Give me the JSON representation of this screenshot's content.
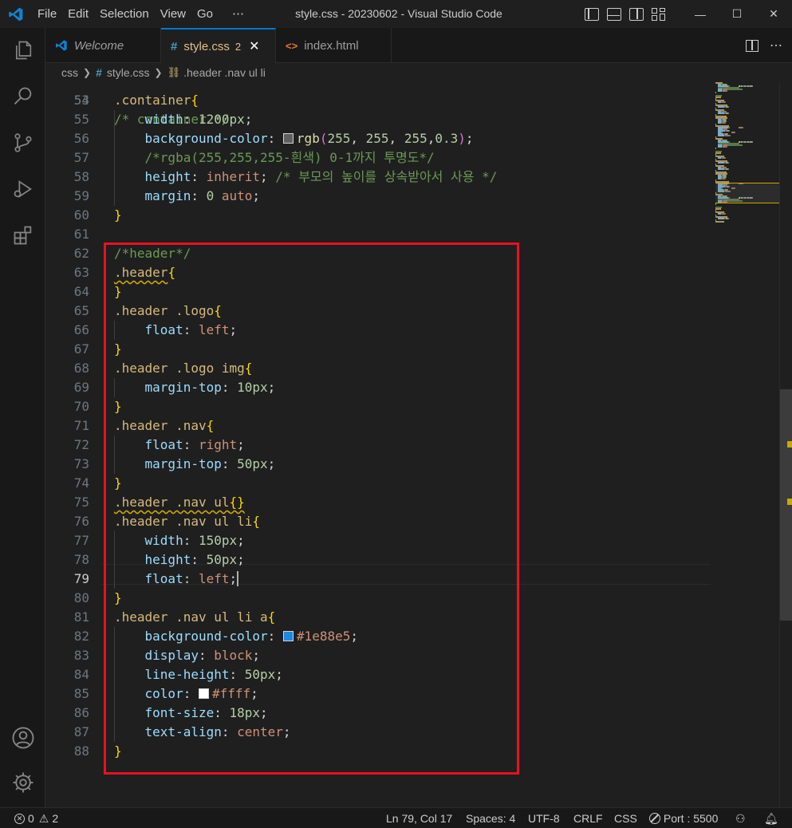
{
  "window": {
    "title": "style.css - 20230602 - Visual Studio Code",
    "menu": [
      "File",
      "Edit",
      "Selection",
      "View",
      "Go",
      "⋯"
    ],
    "controls": {
      "minimize": "—",
      "maximize": "☐",
      "close": "✕"
    }
  },
  "tabs": [
    {
      "label": "Welcome",
      "icon": "vscode-logo-icon",
      "active": false
    },
    {
      "label": "style.css",
      "icon": "css-hash-icon",
      "badge": "2",
      "active": true
    },
    {
      "label": "index.html",
      "icon": "html-brackets-icon",
      "active": false
    }
  ],
  "breadcrumb": {
    "folder": "css",
    "file": "style.css",
    "symbol": ".header .nav ul li"
  },
  "editor": {
    "current_line": 79,
    "partial_top_line": {
      "number": "53",
      "text": "/* container */"
    },
    "lines": [
      {
        "n": "54",
        "tokens": [
          [
            ".container",
            "sel"
          ],
          [
            "{",
            "brace"
          ]
        ]
      },
      {
        "n": "55",
        "tokens": [
          [
            "    ",
            "punct"
          ],
          [
            "width",
            "prop"
          ],
          [
            ": ",
            "punct"
          ],
          [
            "1200px",
            "num"
          ],
          [
            ";",
            "punct"
          ]
        ]
      },
      {
        "n": "56",
        "tokens": [
          [
            "    ",
            "punct"
          ],
          [
            "background-color",
            "prop"
          ],
          [
            ": ",
            "punct"
          ],
          [
            "swatch:#5f5f5f",
            "swatch"
          ],
          [
            "rgb",
            "fn"
          ],
          [
            "(",
            "paren"
          ],
          [
            "255",
            "num"
          ],
          [
            ", ",
            "punct"
          ],
          [
            "255",
            "num"
          ],
          [
            ", ",
            "punct"
          ],
          [
            "255",
            "num"
          ],
          [
            ",",
            "punct"
          ],
          [
            "0.3",
            "num"
          ],
          [
            ")",
            "paren"
          ],
          [
            ";",
            "punct"
          ]
        ]
      },
      {
        "n": "57",
        "tokens": [
          [
            "    ",
            "punct"
          ],
          [
            "/*rgba(255,255,255-흰색) 0-1까지 투명도*/",
            "comment"
          ]
        ]
      },
      {
        "n": "58",
        "tokens": [
          [
            "    ",
            "punct"
          ],
          [
            "height",
            "prop"
          ],
          [
            ": ",
            "punct"
          ],
          [
            "inherit",
            "val"
          ],
          [
            "; ",
            "punct"
          ],
          [
            "/* 부모의 높이를 상속받아서 사용 */",
            "comment"
          ]
        ]
      },
      {
        "n": "59",
        "tokens": [
          [
            "    ",
            "punct"
          ],
          [
            "margin",
            "prop"
          ],
          [
            ": ",
            "punct"
          ],
          [
            "0",
            "num"
          ],
          [
            " ",
            "punct"
          ],
          [
            "auto",
            "val"
          ],
          [
            ";",
            "punct"
          ]
        ]
      },
      {
        "n": "60",
        "tokens": [
          [
            "}",
            "brace"
          ]
        ]
      },
      {
        "n": "61",
        "tokens": []
      },
      {
        "n": "62",
        "tokens": [
          [
            "/*header*/",
            "comment"
          ]
        ]
      },
      {
        "n": "63",
        "tokens": [
          [
            ".header",
            "sel squiggle"
          ],
          [
            "{",
            "brace"
          ]
        ]
      },
      {
        "n": "64",
        "tokens": [
          [
            "}",
            "brace"
          ]
        ]
      },
      {
        "n": "65",
        "tokens": [
          [
            ".header .logo",
            "sel"
          ],
          [
            "{",
            "brace"
          ]
        ]
      },
      {
        "n": "66",
        "tokens": [
          [
            "    ",
            "punct"
          ],
          [
            "float",
            "prop"
          ],
          [
            ": ",
            "punct"
          ],
          [
            "left",
            "val"
          ],
          [
            ";",
            "punct"
          ]
        ]
      },
      {
        "n": "67",
        "tokens": [
          [
            "}",
            "brace"
          ]
        ]
      },
      {
        "n": "68",
        "tokens": [
          [
            ".header .logo img",
            "sel"
          ],
          [
            "{",
            "brace"
          ]
        ]
      },
      {
        "n": "69",
        "tokens": [
          [
            "    ",
            "punct"
          ],
          [
            "margin-top",
            "prop"
          ],
          [
            ": ",
            "punct"
          ],
          [
            "10px",
            "num"
          ],
          [
            ";",
            "punct"
          ]
        ]
      },
      {
        "n": "70",
        "tokens": [
          [
            "}",
            "brace"
          ]
        ]
      },
      {
        "n": "71",
        "tokens": [
          [
            ".header .nav",
            "sel"
          ],
          [
            "{",
            "brace"
          ]
        ]
      },
      {
        "n": "72",
        "tokens": [
          [
            "    ",
            "punct"
          ],
          [
            "float",
            "prop"
          ],
          [
            ": ",
            "punct"
          ],
          [
            "right",
            "val"
          ],
          [
            ";",
            "punct"
          ]
        ]
      },
      {
        "n": "73",
        "tokens": [
          [
            "    ",
            "punct"
          ],
          [
            "margin-top",
            "prop"
          ],
          [
            ": ",
            "punct"
          ],
          [
            "50px",
            "num"
          ],
          [
            ";",
            "punct"
          ]
        ]
      },
      {
        "n": "74",
        "tokens": [
          [
            "}",
            "brace"
          ]
        ]
      },
      {
        "n": "75",
        "tokens": [
          [
            ".header .nav ul",
            "sel squiggle"
          ],
          [
            "{}",
            "brace squiggle"
          ]
        ]
      },
      {
        "n": "76",
        "tokens": [
          [
            ".header .nav ul li",
            "sel"
          ],
          [
            "{",
            "brace"
          ]
        ]
      },
      {
        "n": "77",
        "tokens": [
          [
            "    ",
            "punct"
          ],
          [
            "width",
            "prop"
          ],
          [
            ": ",
            "punct"
          ],
          [
            "150px",
            "num"
          ],
          [
            ";",
            "punct"
          ]
        ]
      },
      {
        "n": "78",
        "tokens": [
          [
            "    ",
            "punct"
          ],
          [
            "height",
            "prop"
          ],
          [
            ": ",
            "punct"
          ],
          [
            "50px",
            "num"
          ],
          [
            ";",
            "punct"
          ]
        ]
      },
      {
        "n": "79",
        "tokens": [
          [
            "    ",
            "punct"
          ],
          [
            "float",
            "prop"
          ],
          [
            ": ",
            "punct"
          ],
          [
            "left",
            "val"
          ],
          [
            ";",
            "punct"
          ],
          [
            "",
            "cursor"
          ]
        ]
      },
      {
        "n": "80",
        "tokens": [
          [
            "}",
            "brace"
          ]
        ]
      },
      {
        "n": "81",
        "tokens": [
          [
            ".header .nav ul li a",
            "sel"
          ],
          [
            "{",
            "brace"
          ]
        ]
      },
      {
        "n": "82",
        "tokens": [
          [
            "    ",
            "punct"
          ],
          [
            "background-color",
            "prop"
          ],
          [
            ": ",
            "punct"
          ],
          [
            "swatch:#1e88e5",
            "swatch"
          ],
          [
            "#1e88e5",
            "val"
          ],
          [
            ";",
            "punct"
          ]
        ]
      },
      {
        "n": "83",
        "tokens": [
          [
            "    ",
            "punct"
          ],
          [
            "display",
            "prop"
          ],
          [
            ": ",
            "punct"
          ],
          [
            "block",
            "val"
          ],
          [
            ";",
            "punct"
          ]
        ]
      },
      {
        "n": "84",
        "tokens": [
          [
            "    ",
            "punct"
          ],
          [
            "line-height",
            "prop"
          ],
          [
            ": ",
            "punct"
          ],
          [
            "50px",
            "num"
          ],
          [
            ";",
            "punct"
          ]
        ]
      },
      {
        "n": "85",
        "tokens": [
          [
            "    ",
            "punct"
          ],
          [
            "color",
            "prop"
          ],
          [
            ": ",
            "punct"
          ],
          [
            "swatch:#ffffff",
            "swatch"
          ],
          [
            "#ffff",
            "val"
          ],
          [
            ";",
            "punct"
          ]
        ]
      },
      {
        "n": "86",
        "tokens": [
          [
            "    ",
            "punct"
          ],
          [
            "font-size",
            "prop"
          ],
          [
            ": ",
            "punct"
          ],
          [
            "18px",
            "num"
          ],
          [
            ";",
            "punct"
          ]
        ]
      },
      {
        "n": "87",
        "tokens": [
          [
            "    ",
            "punct"
          ],
          [
            "text-align",
            "prop"
          ],
          [
            ": ",
            "punct"
          ],
          [
            "center",
            "val"
          ],
          [
            ";",
            "punct"
          ]
        ]
      },
      {
        "n": "88",
        "tokens": [
          [
            "}",
            "brace"
          ]
        ]
      }
    ]
  },
  "statusbar": {
    "errors": "0",
    "warnings": "2",
    "position": "Ln 79, Col 17",
    "spaces": "Spaces: 4",
    "encoding": "UTF-8",
    "eol": "CRLF",
    "language": "CSS",
    "port": "Port : 5500"
  },
  "colors": {
    "accent": "#0078d4",
    "highlight_box": "#e81123",
    "modified_tab": "#e2c08d",
    "warning": "#cca700"
  }
}
